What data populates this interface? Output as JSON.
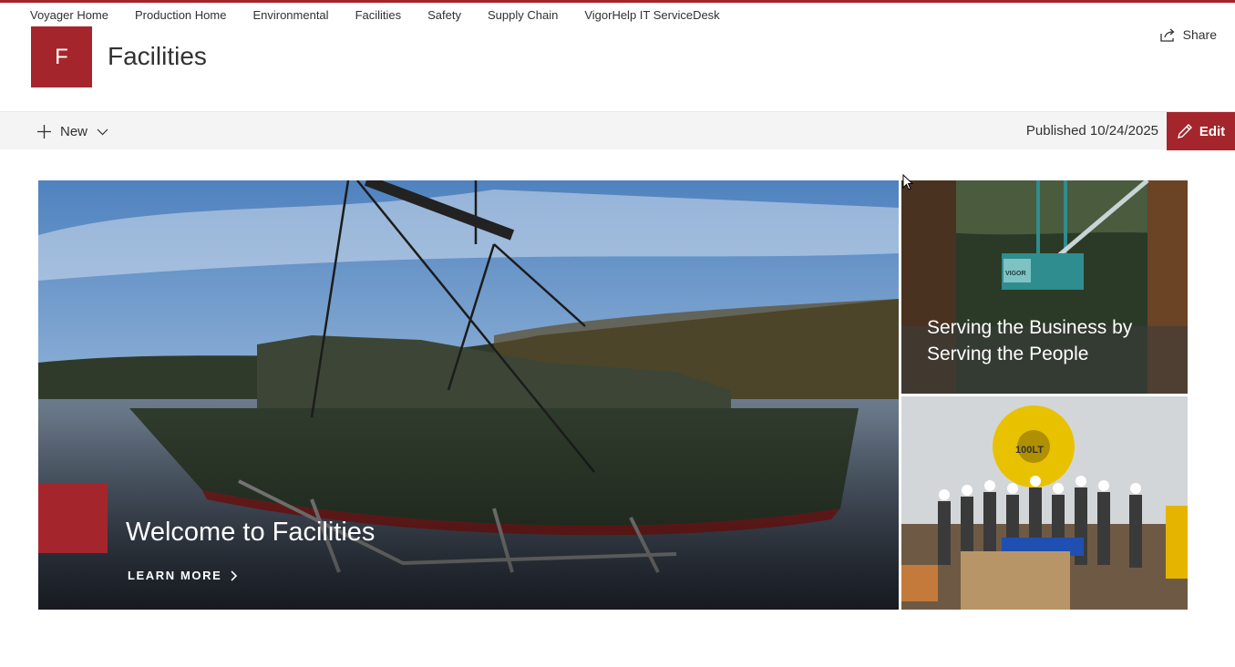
{
  "hub_nav": {
    "items": [
      {
        "label": "Voyager Home"
      },
      {
        "label": "Production Home"
      },
      {
        "label": "Environmental"
      },
      {
        "label": "Facilities"
      },
      {
        "label": "Safety"
      },
      {
        "label": "Supply Chain"
      },
      {
        "label": "VigorHelp IT ServiceDesk"
      }
    ]
  },
  "header": {
    "logo_letter": "F",
    "site_title": "Facilities",
    "share_label": "Share"
  },
  "command_bar": {
    "new_label": "New",
    "published_text": "Published 10/24/2025",
    "edit_label": "Edit"
  },
  "hero": {
    "main": {
      "title": "Welcome to Facilities",
      "link_label": "LEARN MORE"
    },
    "side_top": {
      "title": "Serving the Business by Serving the People",
      "sign_text": "VIGOR"
    },
    "side_bottom": {
      "hook_text": "100LT"
    }
  },
  "theme": {
    "accent": "#a4262c",
    "command_bar_bg": "#f4f4f4"
  },
  "icons": [
    "share-icon",
    "plus-icon",
    "chevron-down-icon",
    "pencil-icon",
    "chevron-right-icon",
    "mouse-cursor"
  ]
}
